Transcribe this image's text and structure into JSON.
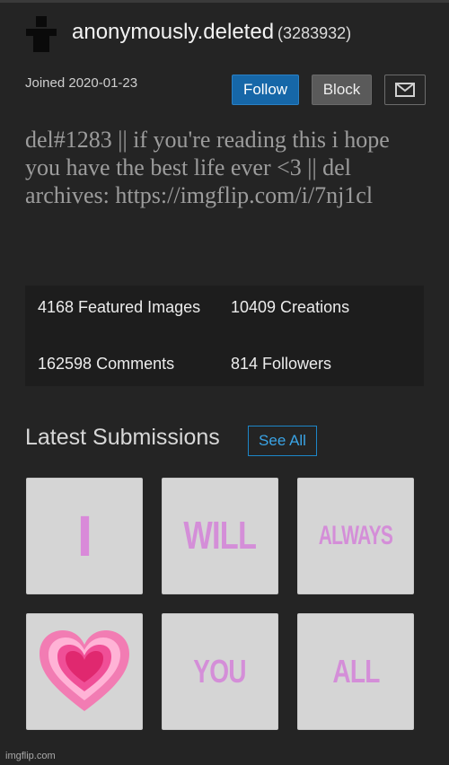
{
  "profile": {
    "username": "anonymously.deleted",
    "user_id": "(3283932)",
    "joined": "Joined 2020-01-23",
    "bio": "del#1283 || if you're reading this i hope you have the best life ever <3 || del archives: https://imgflip.com/i/7nj1cl"
  },
  "actions": {
    "follow_label": "Follow",
    "block_label": "Block",
    "message_icon": "envelope-icon"
  },
  "stats": {
    "featured": "4168 Featured Images",
    "creations": "10409 Creations",
    "comments": "162598 Comments",
    "followers": "814 Followers"
  },
  "latest": {
    "title": "Latest Submissions",
    "see_all_label": "See All",
    "thumbnails": [
      {
        "text": "I"
      },
      {
        "text": "WILL"
      },
      {
        "text": "ALWAYS"
      },
      {
        "icon": "heart-icon"
      },
      {
        "text": "YOU"
      },
      {
        "text": "ALL"
      }
    ]
  },
  "footer": {
    "watermark": "imgflip.com"
  },
  "colors": {
    "background": "#242424",
    "follow_button": "#1667a8",
    "see_all_border": "#1d86c8",
    "thumb_text": "#d48ed8",
    "heart": "#e0286f"
  }
}
